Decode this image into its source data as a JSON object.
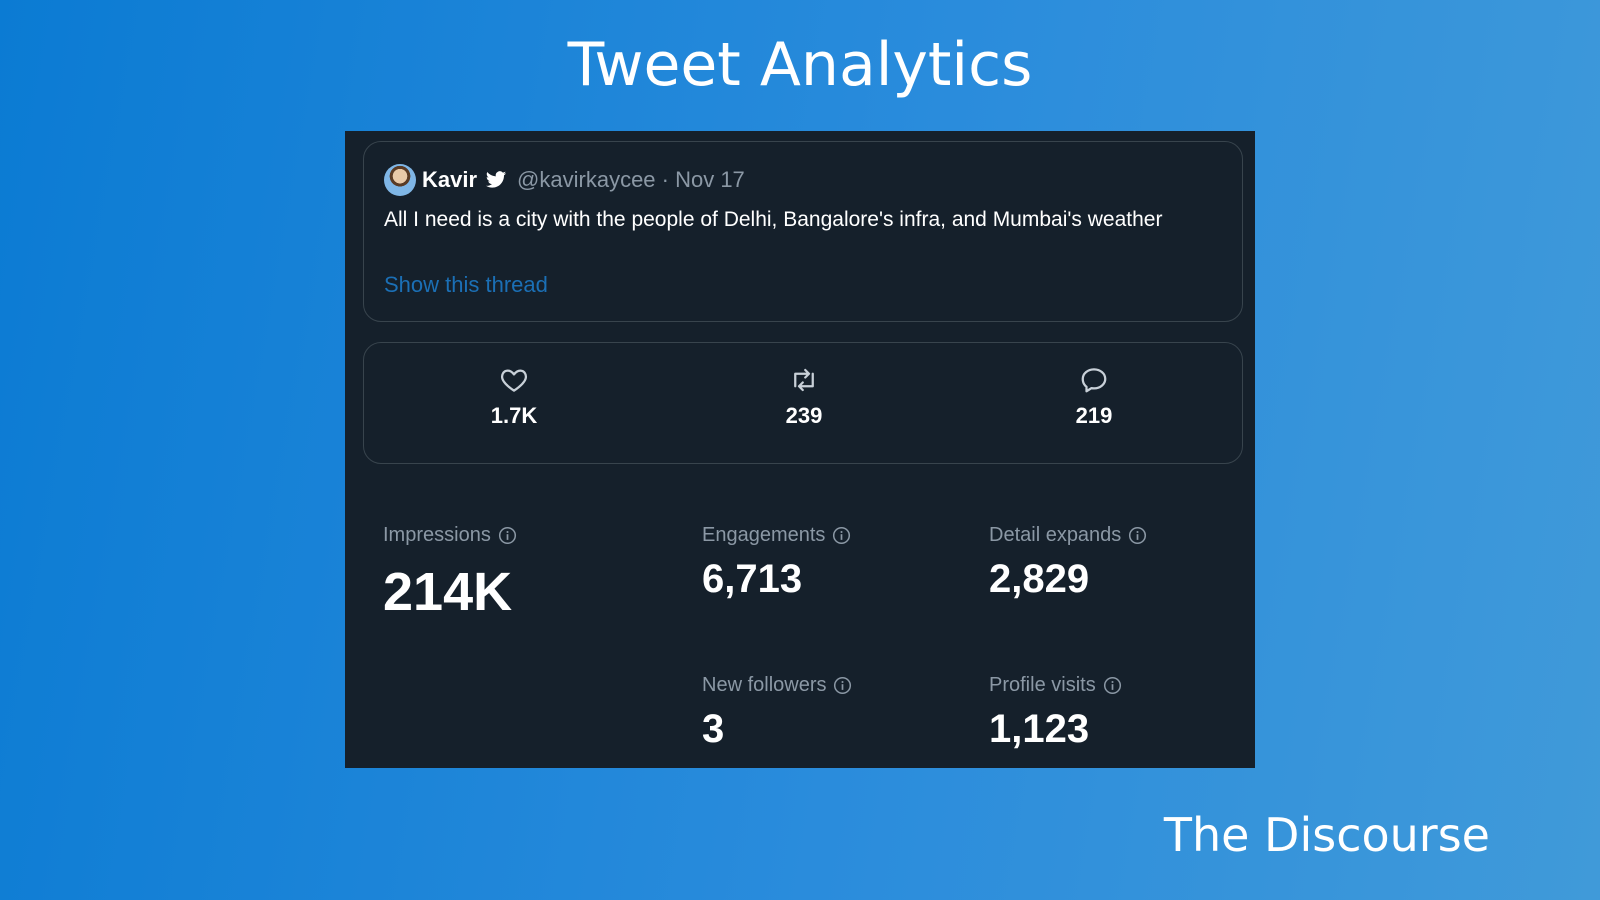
{
  "slide": {
    "title": "Tweet Analytics",
    "brand": "The Discourse"
  },
  "tweet": {
    "author_name": "Kavir",
    "handle_date": "@kavirkaycee · Nov 17",
    "text": "All I need is a city with the people of Delhi, Bangalore's infra, and Mumbai's weather",
    "thread_link": "Show this thread"
  },
  "actions": {
    "likes": "1.7K",
    "retweets": "239",
    "replies": "219"
  },
  "metrics": {
    "impressions": {
      "label": "Impressions",
      "value": "214K"
    },
    "engagements": {
      "label": "Engagements",
      "value": "6,713"
    },
    "detail_expands": {
      "label": "Detail expands",
      "value": "2,829"
    },
    "new_followers": {
      "label": "New followers",
      "value": "3"
    },
    "profile_visits": {
      "label": "Profile visits",
      "value": "1,123"
    }
  },
  "colors": {
    "background_start": "#0b7bd3",
    "background_end": "#409ad9",
    "panel": "#15202b",
    "border": "#38444d",
    "muted_text": "#8b98a5",
    "link": "#1b6fb5"
  },
  "icons": [
    "verified-bird-icon",
    "heart-icon",
    "retweet-icon",
    "reply-icon",
    "info-icon"
  ]
}
